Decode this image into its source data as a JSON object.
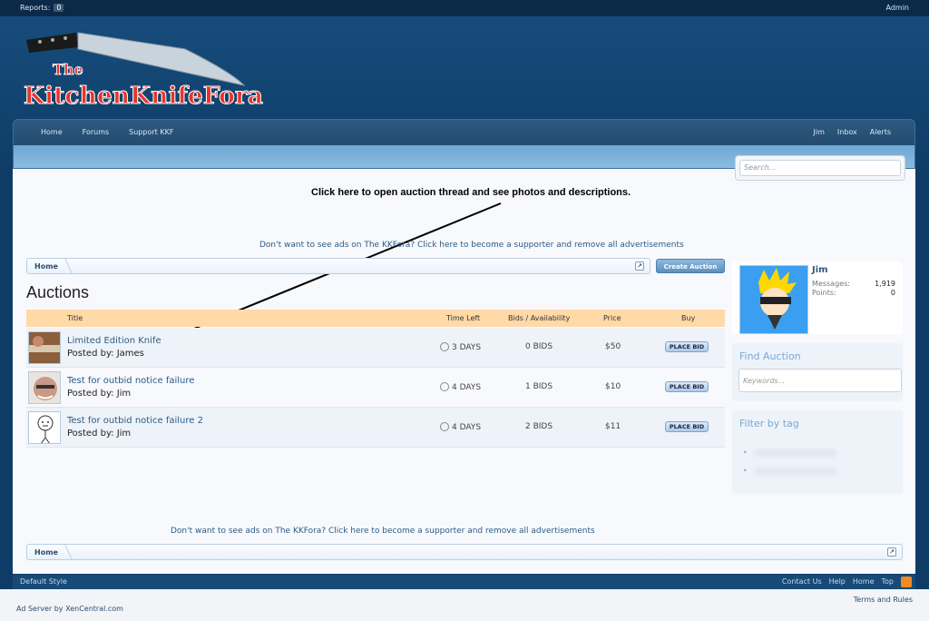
{
  "topbar": {
    "reports_label": "Reports:",
    "reports_count": "0",
    "admin_label": "Admin"
  },
  "logo": {
    "text_the": "The",
    "text_main": "KitchenKnifeFora"
  },
  "nav": {
    "left": [
      "Home",
      "Forums",
      "Support KKF"
    ],
    "right": [
      "Jim",
      "Inbox",
      "Alerts"
    ]
  },
  "search": {
    "placeholder": "Search..."
  },
  "annotation": "Click here to open auction thread and see photos and descriptions.",
  "ad_text": "Don't want to see ads on The KKFora? Click here to become a supporter and remove all advertisements",
  "breadcrumb": {
    "home": "Home",
    "jump_icon": "jump-icon"
  },
  "create_auction_label": "Create Auction",
  "page_title": "Auctions",
  "table": {
    "headers": [
      "Title",
      "Time Left",
      "Bids / Availability",
      "Price",
      "Buy"
    ],
    "rows": [
      {
        "title": "Limited Edition Knife",
        "posted_by": "Posted by: James",
        "time_left": "3 DAYS",
        "bids": "0 BIDS",
        "price": "$50",
        "action": "PLACE BID"
      },
      {
        "title": "Test for outbid notice failure",
        "posted_by": "Posted by: Jim",
        "time_left": "4 DAYS",
        "bids": "1 BIDS",
        "price": "$10",
        "action": "PLACE BID"
      },
      {
        "title": "Test for outbid notice failure 2",
        "posted_by": "Posted by: Jim",
        "time_left": "4 DAYS",
        "bids": "2 BIDS",
        "price": "$11",
        "action": "PLACE BID"
      }
    ]
  },
  "member": {
    "name": "Jim",
    "messages_label": "Messages:",
    "messages_value": "1,919",
    "points_label": "Points:",
    "points_value": "0"
  },
  "find_auction": {
    "title": "Find Auction",
    "placeholder": "Keywords..."
  },
  "filter_by_tag": {
    "title": "Filter by tag",
    "bullets": [
      "•",
      "•"
    ]
  },
  "footer": {
    "style": "Default Style",
    "links": [
      "Contact Us",
      "Help",
      "Home",
      "Top"
    ],
    "terms": "Terms and Rules",
    "ad_server": "Ad Server by XenCentral.com"
  },
  "colors": {
    "accent": "#2b5b85",
    "header_bg": "#164c7c",
    "table_header": "#ffd9a8",
    "rss": "#f08a24"
  }
}
